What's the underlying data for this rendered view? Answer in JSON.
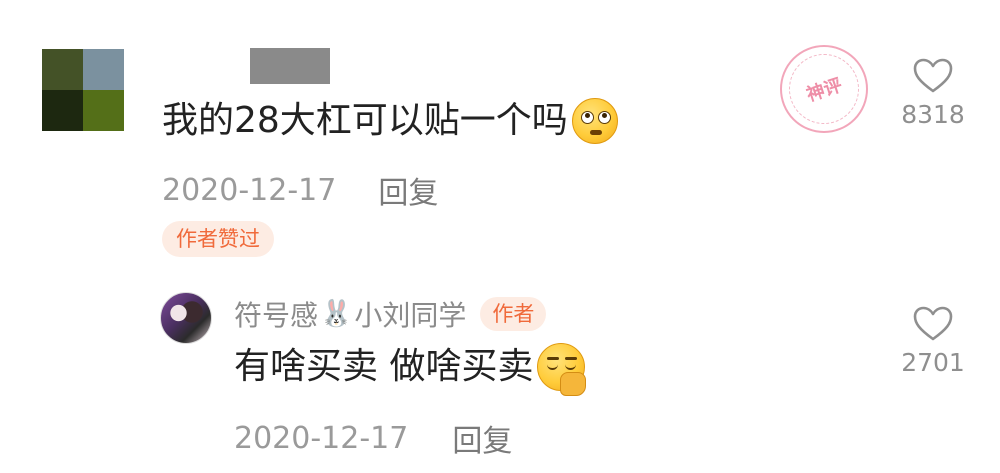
{
  "comment": {
    "avatar_colors": [
      "#445227",
      "#7b919f",
      "#1d2810",
      "#546f18"
    ],
    "text": "我的28大杠可以贴一个吗",
    "emoji": "rolling-eyes-emoji",
    "date": "2020-12-17",
    "reply_label": "回复",
    "liked_badge": "作者赞过",
    "stamp_text": "神评",
    "like_count": "8318"
  },
  "reply": {
    "author_name_part1": "符号感",
    "author_icon": "bunny-icon",
    "author_name_part2": "小刘同学",
    "author_badge": "作者",
    "text": "有啥买卖 做啥买卖",
    "emoji": "shushing-face-emoji",
    "date": "2020-12-17",
    "reply_label": "回复",
    "like_count": "2701"
  },
  "colors": {
    "accent": "#f06a3b",
    "badge_bg": "#fdece3",
    "stamp": "#ee8ea7",
    "meta": "#9a9a9a"
  }
}
